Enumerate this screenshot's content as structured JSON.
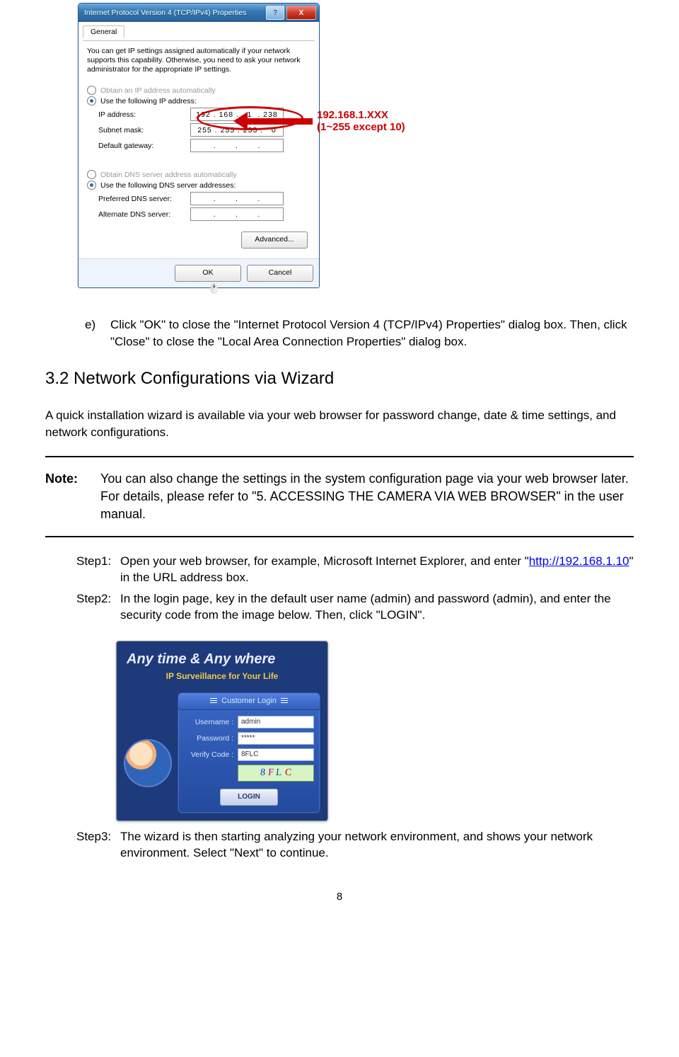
{
  "dialog": {
    "title": "Internet Protocol Version 4 (TCP/IPv4) Properties",
    "help_label": "?",
    "close_label": "X",
    "tab": "General",
    "desc": "You can get IP settings assigned automatically if your network supports this capability. Otherwise, you need to ask your network administrator for the appropriate IP settings.",
    "radio_auto_ip": "Obtain an IP address automatically",
    "radio_use_ip": "Use the following IP address:",
    "ip_label": "IP address:",
    "ip_value": "192 . 168 .   1  . 238",
    "mask_label": "Subnet mask:",
    "mask_value": "255 . 255 . 255 .   0",
    "gw_label": "Default gateway:",
    "gw_value": ".       .       .",
    "radio_auto_dns": "Obtain DNS server address automatically",
    "radio_use_dns": "Use the following DNS server addresses:",
    "pref_dns_label": "Preferred DNS server:",
    "pref_dns_value": ".       .       .",
    "alt_dns_label": "Alternate DNS server:",
    "alt_dns_value": ".       .       .",
    "advanced_btn": "Advanced...",
    "ok_btn": "OK",
    "cancel_btn": "Cancel"
  },
  "callout": {
    "line1": "192.168.1.XXX",
    "line2": "(1~255 except 10)"
  },
  "doc": {
    "item_e_marker": "e)",
    "item_e_text": "Click \"OK\" to close the \"Internet Protocol Version 4 (TCP/IPv4) Properties\" dialog box. Then, click \"Close\" to close the \"Local Area Connection Properties\" dialog box.",
    "section_heading": "3.2 Network Configurations via Wizard",
    "intro": "A quick installation wizard is available via your web browser for password change, date & time settings, and network configurations.",
    "note_label": "Note:",
    "note_body": "You can also change the settings in the system configuration page via your web browser later. For details, please refer to \"5. ACCESSING THE CAMERA VIA WEB BROWSER\" in the user manual.",
    "step1_label": "Step1:",
    "step1_a": "Open your web browser, for example, Microsoft Internet Explorer, and enter \"",
    "step1_link": "http://192.168.1.10",
    "step1_b": "\" in the URL address box.",
    "step2_label": "Step2:",
    "step2_text": "In the login page, key in the default user name (admin) and password (admin), and enter the security code from the image below. Then, click \"LOGIN\".",
    "step3_label": "Step3:",
    "step3_text": "The wizard is then starting analyzing your network environment, and shows your network environment. Select \"Next\" to continue."
  },
  "login": {
    "brand": "Any time & Any where",
    "sub": "IP Surveillance for Your Life",
    "panel_title": "Customer Login",
    "username_label": "Username :",
    "username_value": "admin",
    "password_label": "Password :",
    "password_value": "*****",
    "verify_label": "Verify Code :",
    "verify_value": "8FLC",
    "captcha_c1": "8",
    "captcha_c2": "F",
    "captcha_c3": "L",
    "captcha_c4": "C",
    "login_btn": "LOGIN"
  },
  "page_number": "8"
}
